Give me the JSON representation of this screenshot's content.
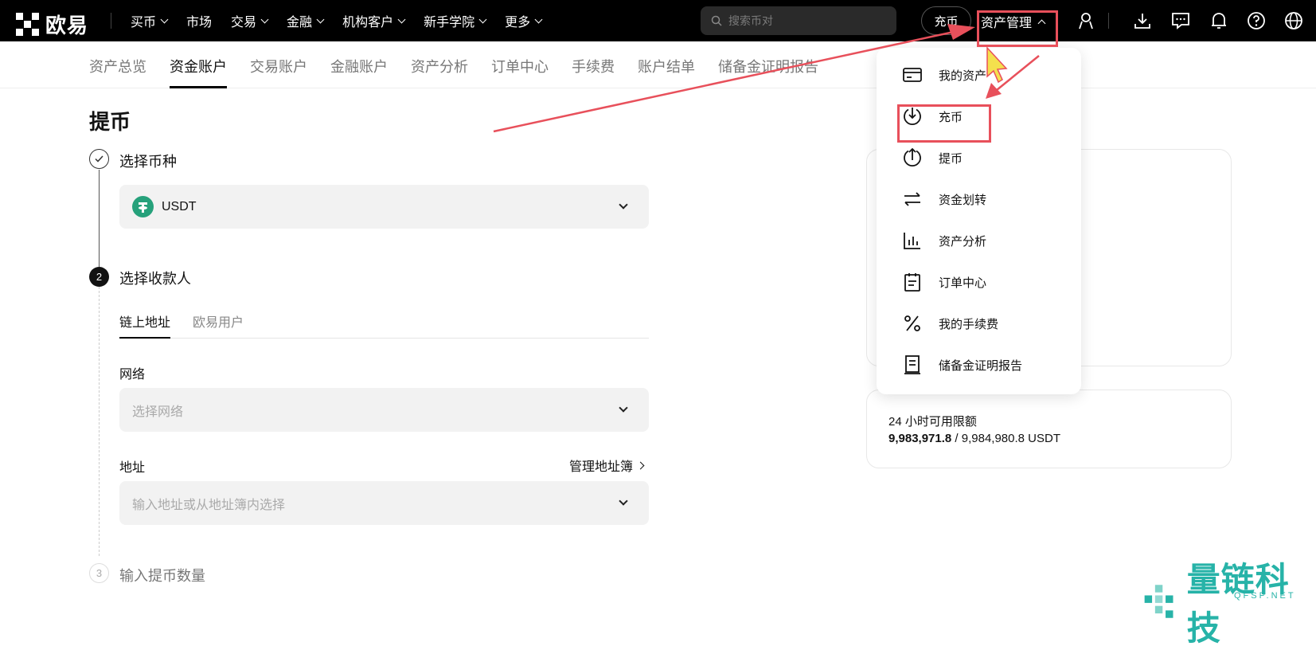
{
  "brand": {
    "name": "欧易"
  },
  "topnav": {
    "items": [
      {
        "label": "买币",
        "has_dropdown": true
      },
      {
        "label": "市场",
        "has_dropdown": false
      },
      {
        "label": "交易",
        "has_dropdown": true
      },
      {
        "label": "金融",
        "has_dropdown": true
      },
      {
        "label": "机构客户",
        "has_dropdown": true
      },
      {
        "label": "新手学院",
        "has_dropdown": true
      },
      {
        "label": "更多",
        "has_dropdown": true
      }
    ],
    "search_placeholder": "搜索币对",
    "deposit_label": "充币",
    "asset_management_label": "资产管理"
  },
  "subnav": {
    "items": [
      "资产总览",
      "资金账户",
      "交易账户",
      "金融账户",
      "资产分析",
      "订单中心",
      "手续费",
      "账户结单",
      "储备金证明报告"
    ],
    "active_index": 1
  },
  "page": {
    "title": "提币",
    "step1": {
      "title": "选择币种",
      "coin": "USDT"
    },
    "step2": {
      "number": "2",
      "title": "选择收款人",
      "tabs": [
        "链上地址",
        "欧易用户"
      ],
      "network_label": "网络",
      "network_placeholder": "选择网络",
      "address_label": "地址",
      "manage_link": "管理地址簿",
      "address_placeholder": "输入地址或从地址簿内选择"
    },
    "step3": {
      "number": "3",
      "title": "输入提币数量"
    }
  },
  "limit_card": {
    "label": "24 小时可用限额",
    "available": "9,983,971.8",
    "separator": " / ",
    "total": "9,984,980.8 USDT"
  },
  "dropdown": {
    "items": [
      {
        "label": "我的资产",
        "icon": "wallet-icon"
      },
      {
        "label": "充币",
        "icon": "deposit-icon"
      },
      {
        "label": "提币",
        "icon": "withdraw-icon"
      },
      {
        "label": "资金划转",
        "icon": "transfer-icon"
      },
      {
        "label": "资产分析",
        "icon": "analysis-icon"
      },
      {
        "label": "订单中心",
        "icon": "order-icon"
      },
      {
        "label": "我的手续费",
        "icon": "percent-icon"
      },
      {
        "label": "储备金证明报告",
        "icon": "report-icon"
      }
    ]
  },
  "watermark": {
    "text": "量链科技",
    "sub": "QFSP.NET"
  },
  "colors": {
    "annotation_red": "#e8505b",
    "watermark_teal": "#27b3a8",
    "usdt_green": "#26a17b"
  }
}
